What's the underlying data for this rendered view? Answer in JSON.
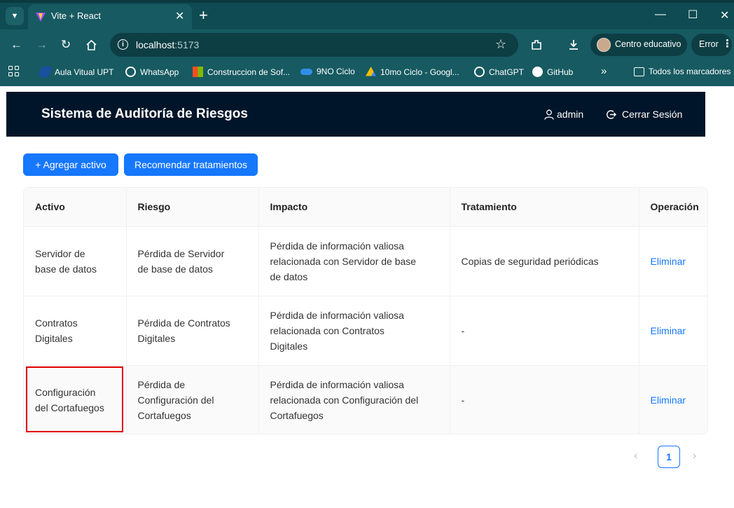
{
  "browser": {
    "tab_title": "Vite + React",
    "url_host": "localhost",
    "url_port": ":5173",
    "profile_name": "Centro educativo",
    "error_label": "Error",
    "bookmarks": [
      {
        "label": "Aula Vitual UPT",
        "icon_color": "#1a4fa0"
      },
      {
        "label": "WhatsApp",
        "icon_color": "#ffffff"
      },
      {
        "label": "Construccion de Sof...",
        "icon_color": "#f25022"
      },
      {
        "label": "9NO Ciclo",
        "icon_color": "#2f8fe6"
      },
      {
        "label": "10mo Ciclo - Googl...",
        "icon_color": "#fbbc04"
      },
      {
        "label": "ChatGPT",
        "icon_color": "#ffffff"
      },
      {
        "label": "GitHub",
        "icon_color": "#ffffff"
      }
    ],
    "bookmarks_overflow": "»",
    "all_bookmarks_label": "Todos los marcadores"
  },
  "app": {
    "title": "Sistema de Auditoría de Riesgos",
    "user_label": "admin",
    "logout_label": "Cerrar Sesión",
    "add_button": "+ Agregar activo",
    "recommend_button": "Recomendar tratamientos"
  },
  "table": {
    "headers": [
      "Activo",
      "Riesgo",
      "Impacto",
      "Tratamiento",
      "Operación"
    ],
    "rows": [
      {
        "activo": "Servidor de base de datos",
        "riesgo": "Pérdida de Servidor de base de datos",
        "impacto": "Pérdida de información valiosa relacionada con Servidor de base de datos",
        "tratamiento": "Copias de seguridad periódicas",
        "operacion": "Eliminar"
      },
      {
        "activo": "Contratos Digitales",
        "riesgo": "Pérdida de Contratos Digitales",
        "impacto": "Pérdida de información valiosa relacionada con Contratos Digitales",
        "tratamiento": "-",
        "operacion": "Eliminar"
      },
      {
        "activo": "Configuración del Cortafuegos",
        "riesgo": "Pérdida de Configuración del Cortafuegos",
        "impacto": "Pérdida de información valiosa relacionada con Configuración del Cortafuegos",
        "tratamiento": "-",
        "operacion": "Eliminar"
      }
    ]
  },
  "pagination": {
    "prev": "‹",
    "current": "1",
    "next": "›"
  },
  "colors": {
    "header_bg": "#001529",
    "primary": "#1677ff",
    "highlight": "#e00000",
    "browser_frame": "#175a61"
  }
}
